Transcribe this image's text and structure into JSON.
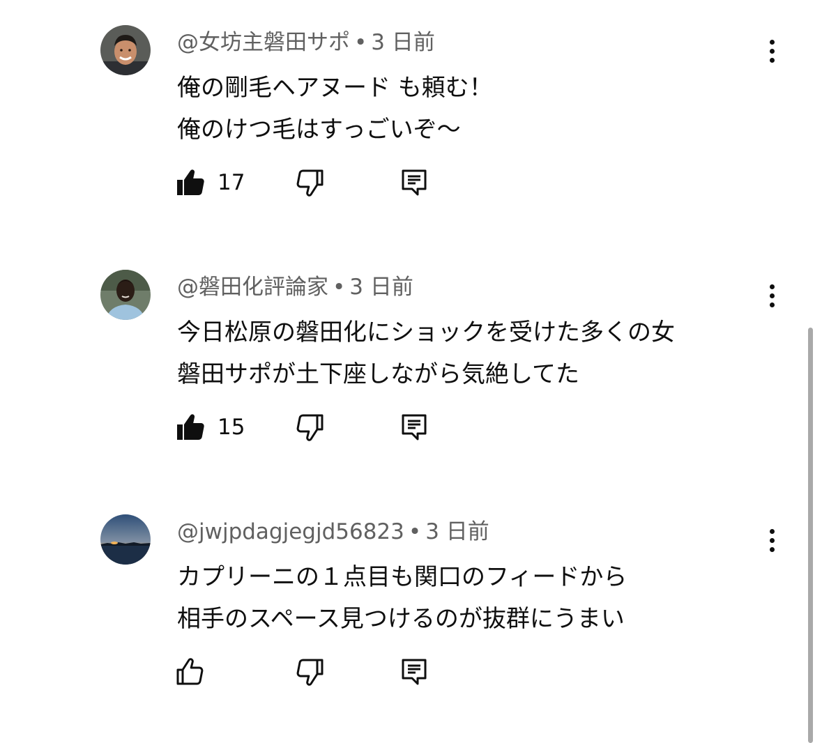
{
  "comments": [
    {
      "handle": "@女坊主磐田サポ",
      "separator": "•",
      "time": "3 日前",
      "lines": [
        "俺の剛毛ヘアヌード も頼む！",
        "俺のけつ毛はすっごいぞ〜"
      ],
      "likes": "17",
      "liked": true,
      "avatar_icon": "person-avatar"
    },
    {
      "handle": "@磐田化評論家",
      "separator": "•",
      "time": "3 日前",
      "lines": [
        "今日松原の磐田化にショックを受けた多くの女",
        "磐田サポが土下座しながら気絶してた"
      ],
      "likes": "15",
      "liked": true,
      "avatar_icon": "person-avatar"
    },
    {
      "handle": "@jwjpdagjegjd56823",
      "separator": "•",
      "time": "3 日前",
      "lines": [
        "カプリーニの１点目も関口のフィードから",
        "相手のスペース見つけるのが抜群にうまい"
      ],
      "likes": "",
      "liked": false,
      "avatar_icon": "sunset-avatar"
    }
  ],
  "icons": {
    "like": "thumbs-up-icon",
    "dislike": "thumbs-down-icon",
    "reply": "reply-icon",
    "more": "more-vertical-icon"
  },
  "colors": {
    "text": "#0f0f0f",
    "secondary": "#606060",
    "scrollbar": "#a9a9a9"
  }
}
